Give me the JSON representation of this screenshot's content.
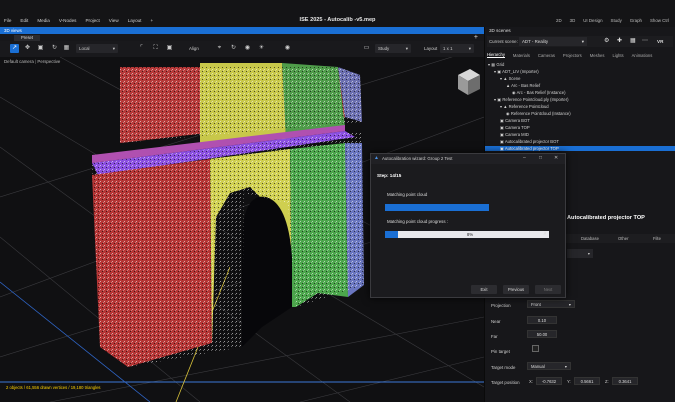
{
  "app": {
    "menu": [
      "File",
      "Edit",
      "Media",
      "V-Nodes",
      "Project",
      "View",
      "Layout",
      "+"
    ],
    "title": "ISE 2025 - Autocalib -v5.mep",
    "right_menu": [
      "2D",
      "3D",
      "UI Design",
      "Study",
      "Graph",
      "Show Ctrl"
    ]
  },
  "viewport": {
    "header": "3D views",
    "tab": "Preset",
    "toolbar": {
      "local_label": "Local",
      "align_label": "Align",
      "study_select": "Study",
      "layout_label": "Layout",
      "layout_value": "1 x 1"
    },
    "camera_label": "Default camera",
    "projection_label": "Perspective",
    "status": "2 objects / 61,556 drawn vertices / 19,180 triangles"
  },
  "panel": {
    "header": "3D scenes",
    "current_scene_label": "Current scene:",
    "current_scene_value": "ADT - Reality",
    "vr_label": "VR",
    "tabs": [
      "Hierarchy",
      "Materials",
      "Cameras",
      "Projectors",
      "Meshes",
      "Lights",
      "Animations"
    ],
    "tree": [
      {
        "label": "Grid",
        "level": 0
      },
      {
        "label": "ADT_LIV (Importer)",
        "level": 1
      },
      {
        "label": "Scene",
        "level": 2
      },
      {
        "label": "Arc - Bas Relief",
        "level": 3
      },
      {
        "label": "Arc - Bas Relief (Instance)",
        "level": 4
      },
      {
        "label": "Reference Pointcloud.ply (Importer)",
        "level": 1
      },
      {
        "label": "Reference Pointcloud",
        "level": 2
      },
      {
        "label": "Reference Pointcloud (Instance)",
        "level": 3
      },
      {
        "label": "Camera BOT",
        "level": 1
      },
      {
        "label": "Camera TOP",
        "level": 1
      },
      {
        "label": "Camera MID",
        "level": 1
      },
      {
        "label": "Autocalibrated projector BOT",
        "level": 1
      },
      {
        "label": "Autocalibrated projector TOP",
        "level": 1,
        "selected": true
      }
    ],
    "props_title": "Autocalibrated projector TOP",
    "props_tabs": [
      "Database",
      "Other",
      "Filte"
    ],
    "fields": {
      "projection_label": "Projection",
      "projection_value": "Front",
      "near_label": "Near",
      "near_value": "0.10",
      "far_label": "Far",
      "far_value": "50.00",
      "pin_target_label": "Pin target",
      "target_mode_label": "Target mode",
      "target_mode_value": "Manual",
      "target_position_label": "Target position",
      "x_label": "X:",
      "x_value": "-0.7632",
      "y_label": "Y:",
      "y_value": "0.5661",
      "z_label": "Z:",
      "z_value": "0.3641"
    }
  },
  "dialog": {
    "title": "Autocalibration wizard: Group 2 Test",
    "step": "Step: 14/15",
    "task1_label": "Matching point cloud",
    "task1_progress": 1.0,
    "task2_label": "Matching point cloud progress :",
    "task2_progress": 0.08,
    "task2_percent": "8%",
    "buttons": {
      "exit": "Exit",
      "previous": "Previous",
      "next": "Next"
    }
  },
  "colors": {
    "accent": "#1a6fd4",
    "status_text": "#ffd200",
    "arch_red": "#c83a3a",
    "arch_yellow": "#d8d84a",
    "arch_green": "#4cae4c",
    "arch_purple": "#8a4fe0"
  }
}
